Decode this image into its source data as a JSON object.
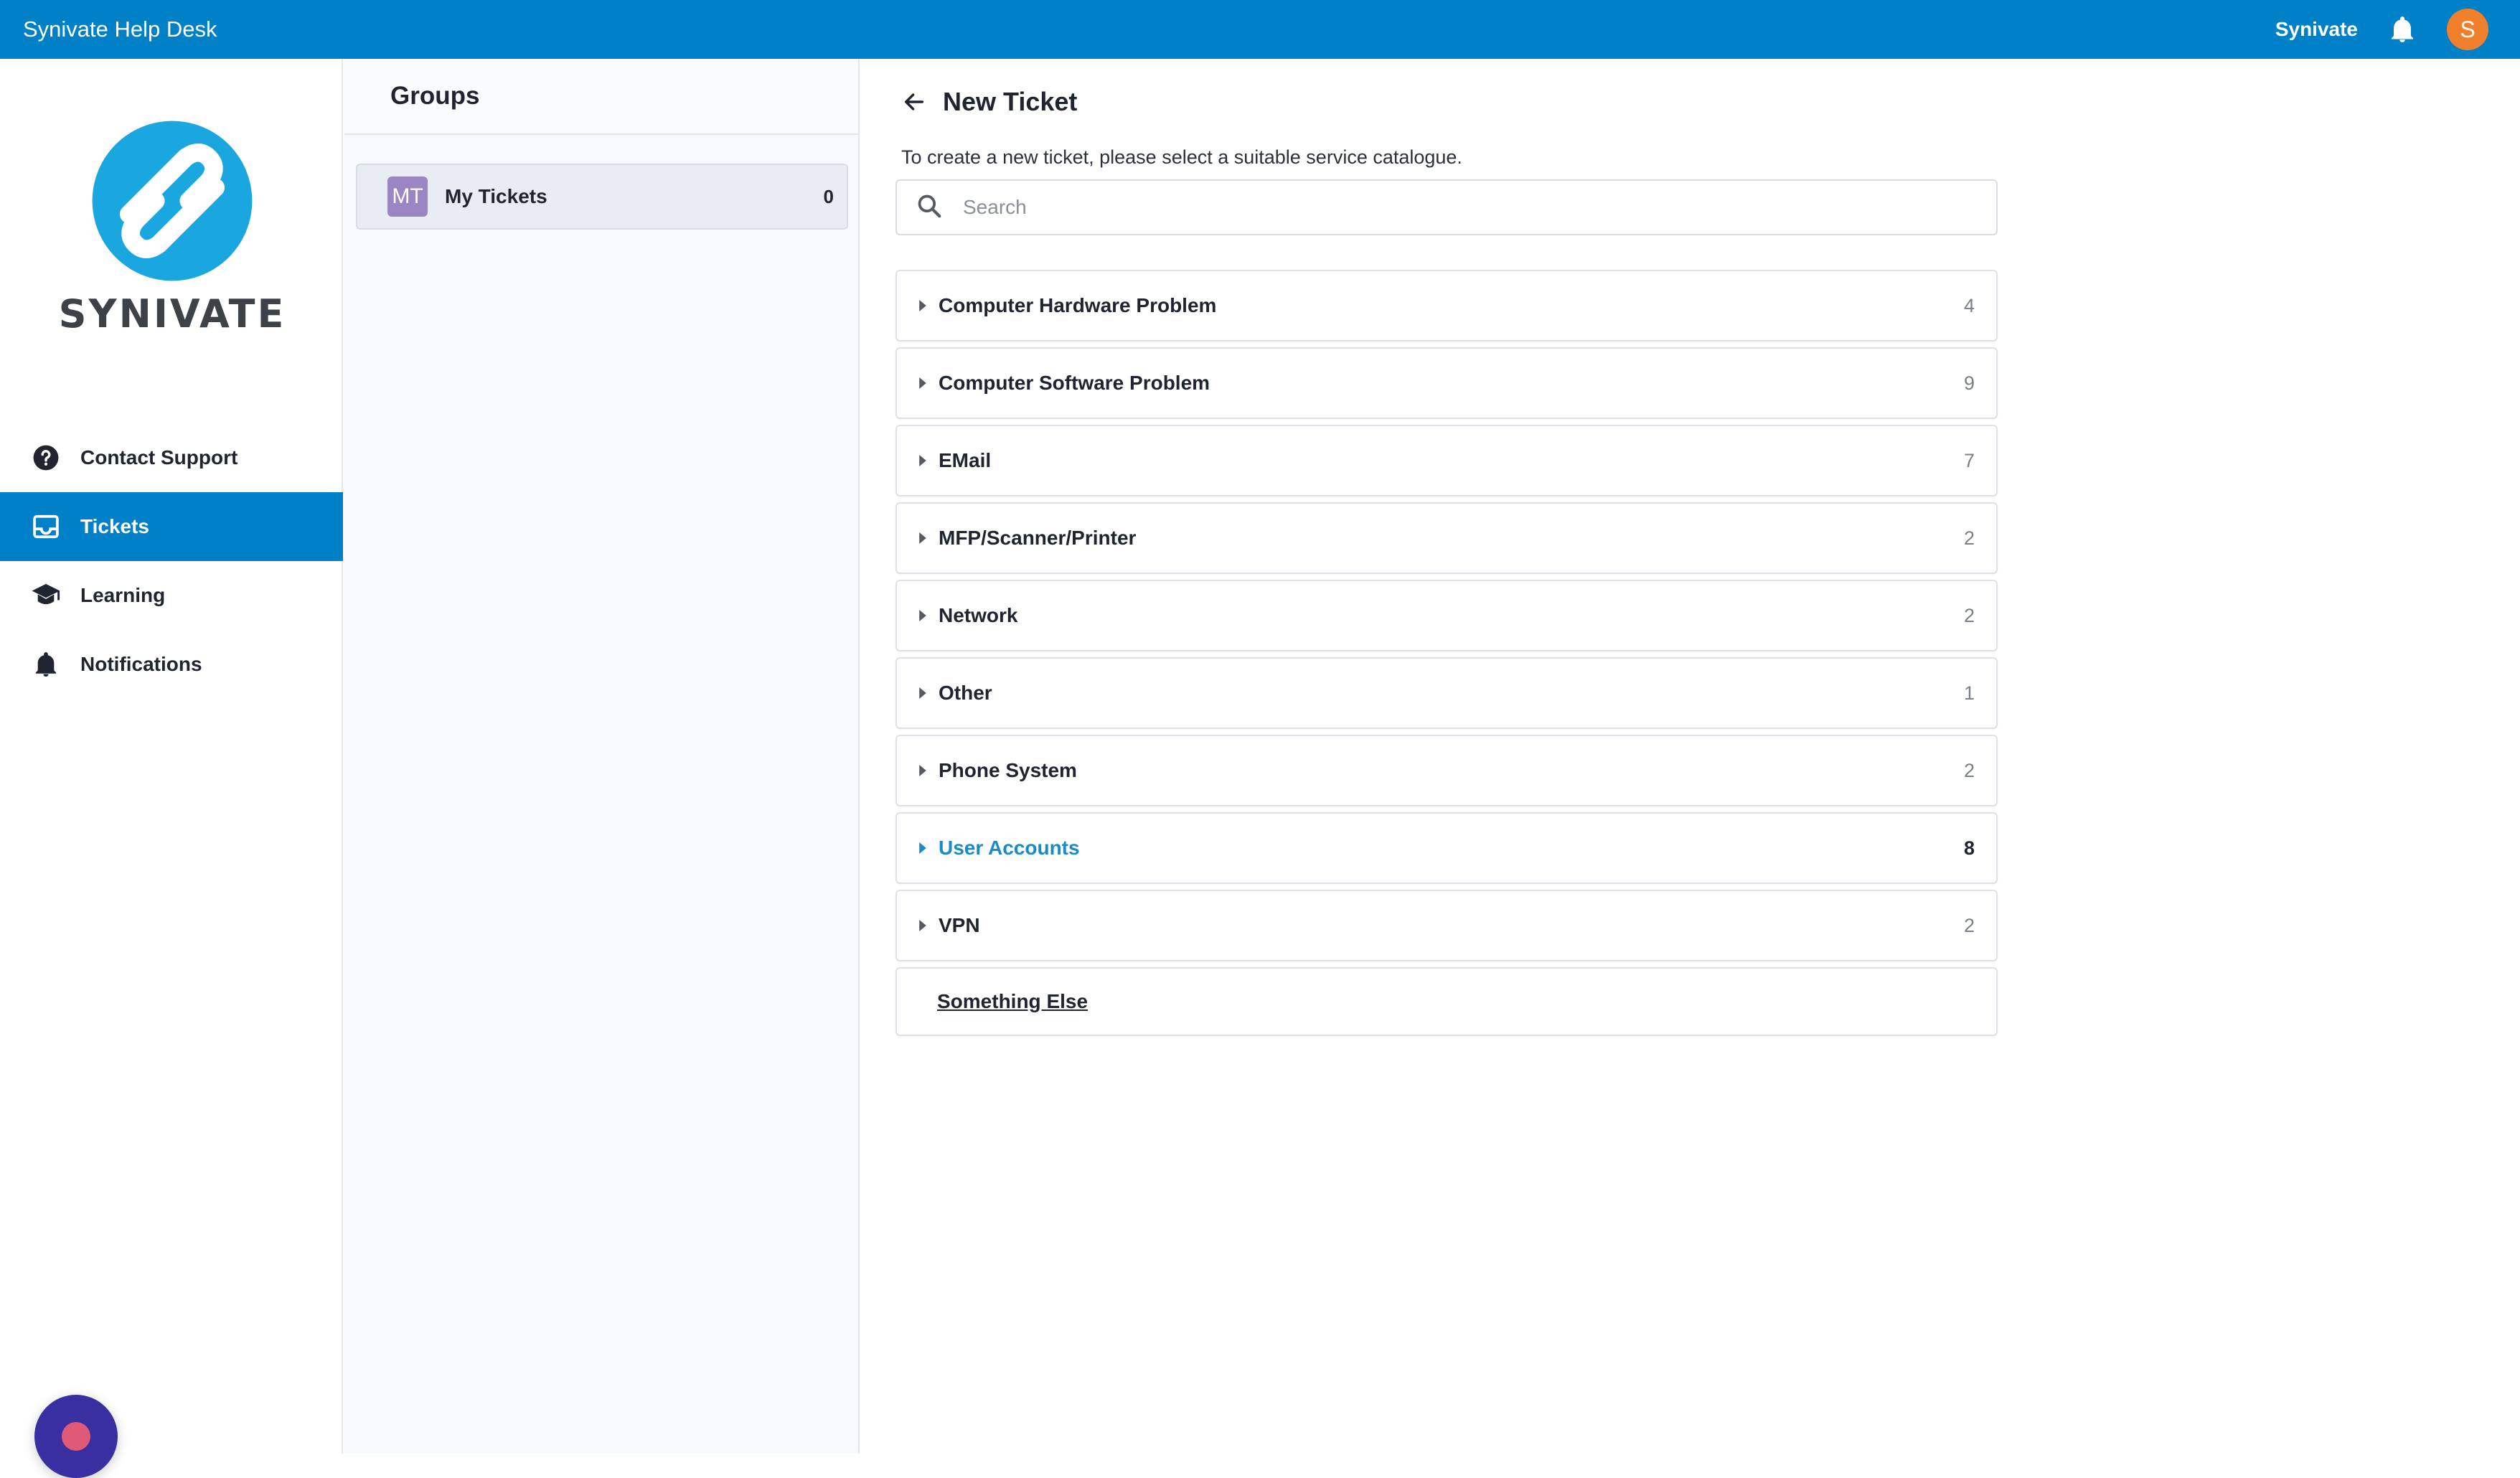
{
  "topbar": {
    "app_title": "Synivate Help Desk",
    "user_name": "Synivate",
    "avatar_initial": "S",
    "bell_icon": "bell-icon",
    "accent_color": "#0080c6"
  },
  "sidebar": {
    "logo_text": "SYNIVATE",
    "items": [
      {
        "label": "Contact Support",
        "icon": "help-circle-icon"
      },
      {
        "label": "Tickets",
        "icon": "inbox-icon",
        "active": true
      },
      {
        "label": "Learning",
        "icon": "graduation-cap-icon"
      },
      {
        "label": "Notifications",
        "icon": "bell-icon"
      }
    ]
  },
  "groups": {
    "title": "Groups",
    "items": [
      {
        "badge": "MT",
        "label": "My Tickets",
        "count": "0"
      }
    ]
  },
  "main": {
    "title": "New Ticket",
    "instructions": "To create a new ticket, please select a suitable service catalogue.",
    "search_placeholder": "Search",
    "catalogues": [
      {
        "label": "Computer Hardware Problem",
        "count": "4"
      },
      {
        "label": "Computer Software Problem",
        "count": "9"
      },
      {
        "label": "EMail",
        "count": "7"
      },
      {
        "label": "MFP/Scanner/Printer",
        "count": "2"
      },
      {
        "label": "Network",
        "count": "2"
      },
      {
        "label": "Other",
        "count": "1"
      },
      {
        "label": "Phone System",
        "count": "2"
      },
      {
        "label": "User Accounts",
        "count": "8",
        "highlight": true
      },
      {
        "label": "VPN",
        "count": "2"
      }
    ],
    "something_else": "Something Else"
  }
}
